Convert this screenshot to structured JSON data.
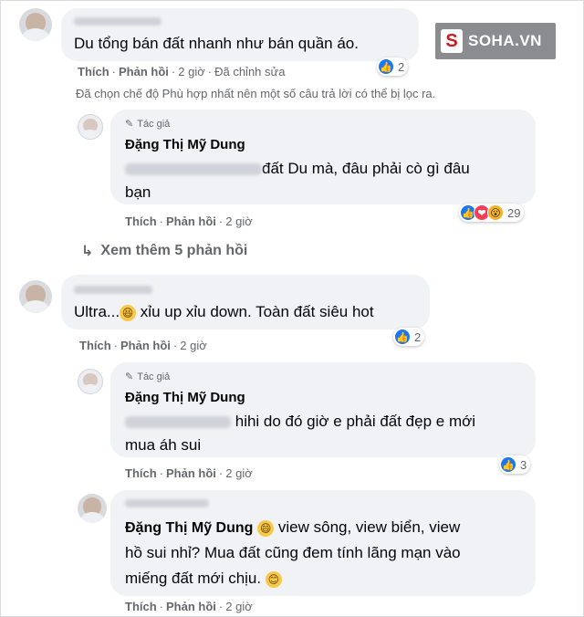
{
  "watermark": {
    "logo_letter": "S",
    "text": "SOHA.VN"
  },
  "comments": [
    {
      "text": "Du tổng bán đất nhanh như bán quần áo.",
      "actions": {
        "like": "Thích",
        "reply": "Phản hồi",
        "time": "2 giờ",
        "edited": "Đã chỉnh sửa"
      },
      "reaction_count": "2"
    },
    {
      "author_badge": "Tác giả",
      "author": "Đặng Thị Mỹ Dung",
      "text_line1": "đất Du mà, đâu phải cò gì đâu",
      "text_line2": "bạn",
      "actions": {
        "like": "Thích",
        "reply": "Phản hồi",
        "time": "2 giờ"
      },
      "reaction_count": "29"
    },
    {
      "text_before": "Ultra...",
      "text_after": " xỉu up xỉu down. Toàn đất siêu hot",
      "actions": {
        "like": "Thích",
        "reply": "Phản hồi",
        "time": "2 giờ"
      },
      "reaction_count": "2"
    },
    {
      "author_badge": "Tác giả",
      "author": "Đặng Thị Mỹ Dung",
      "text_line1": "hihi do đó giờ e phải đất đẹp e mới",
      "text_line2": "mua áh sui",
      "actions": {
        "like": "Thích",
        "reply": "Phản hồi",
        "time": "2 giờ"
      },
      "reaction_count": "3"
    },
    {
      "author": "Đặng Thị Mỹ Dung",
      "text_line1": " view sông, view biển, view",
      "text_line2": "hồ sui nhỉ? Mua đất cũng đem tính lãng mạn vào",
      "text_line3": "miếng đất mới chịu.",
      "actions": {
        "like": "Thích",
        "reply": "Phản hồi",
        "time": "2 giờ"
      }
    }
  ],
  "filter_notice": "Đã chọn chế độ Phù hợp nhất nên một số câu trả lời có thể bị lọc ra.",
  "see_more": "Xem thêm 5 phản hồi",
  "icons": {
    "like": "like-icon",
    "love": "love-icon",
    "wow": "wow-icon",
    "pen": "pen-icon",
    "reply_arrow": "reply-arrow-icon"
  }
}
